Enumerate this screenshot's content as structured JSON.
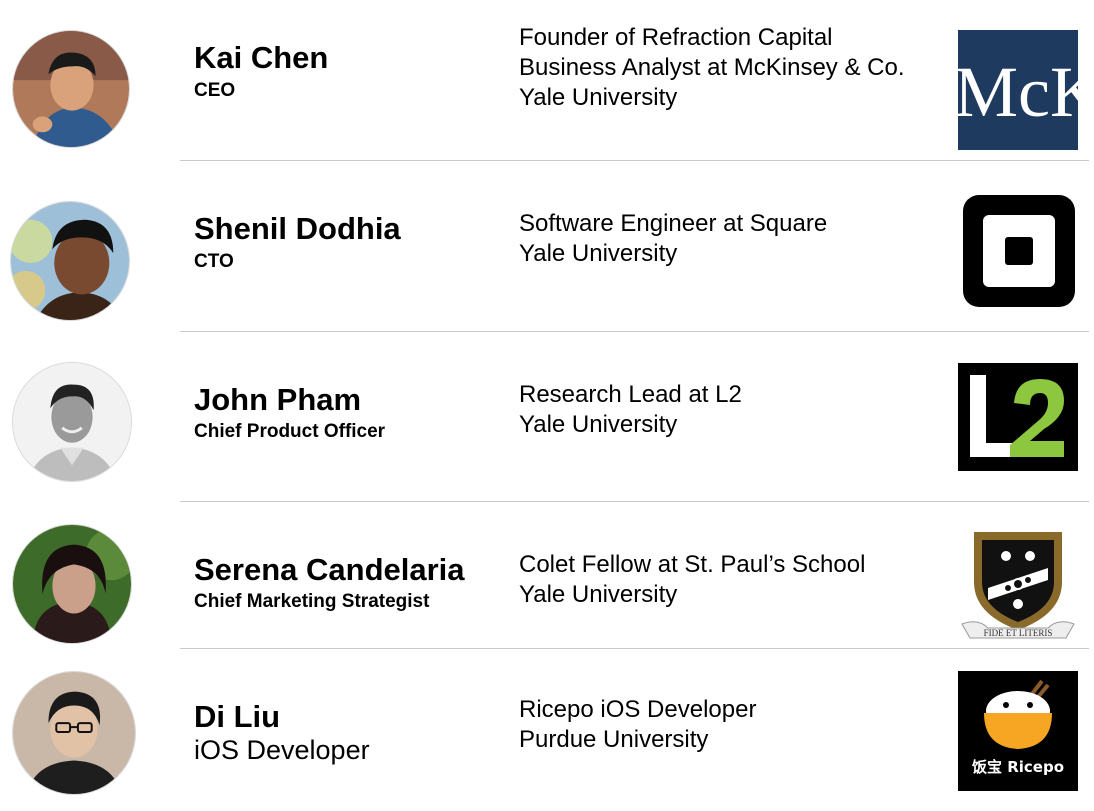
{
  "team": [
    {
      "name": "Kai Chen",
      "role": "CEO",
      "details": [
        "Founder of Refraction Capital",
        "Business Analyst at McKinsey & Co.",
        "Yale University"
      ],
      "logo_text": "McK",
      "logo_icon": "mckinsey-logo"
    },
    {
      "name": "Shenil Dodhia",
      "role": "CTO",
      "details": [
        "Software Engineer at Square",
        "Yale University"
      ],
      "logo_icon": "square-logo"
    },
    {
      "name": "John Pham",
      "role": "Chief Product Officer",
      "details": [
        "Research Lead at L2",
        "Yale University"
      ],
      "logo_text": "L2",
      "logo_icon": "l2-logo"
    },
    {
      "name": "Serena Candelaria",
      "role": "Chief Marketing Strategist",
      "details": [
        "Colet Fellow at St. Paul’s School",
        "Yale University"
      ],
      "logo_text": "FIDE ET LITERIS",
      "logo_icon": "st-pauls-school-crest"
    },
    {
      "name": "Di Liu",
      "role": "iOS Developer",
      "details": [
        "Ricepo iOS Developer",
        "Purdue University"
      ],
      "logo_text": "饭宝 Ricepo",
      "logo_icon": "ricepo-logo"
    }
  ],
  "colors": {
    "mckinsey_bg": "#1f3a5f",
    "l2_green": "#8dc63f",
    "ricepo_orange": "#f6a623",
    "divider": "#c8c8c8"
  }
}
